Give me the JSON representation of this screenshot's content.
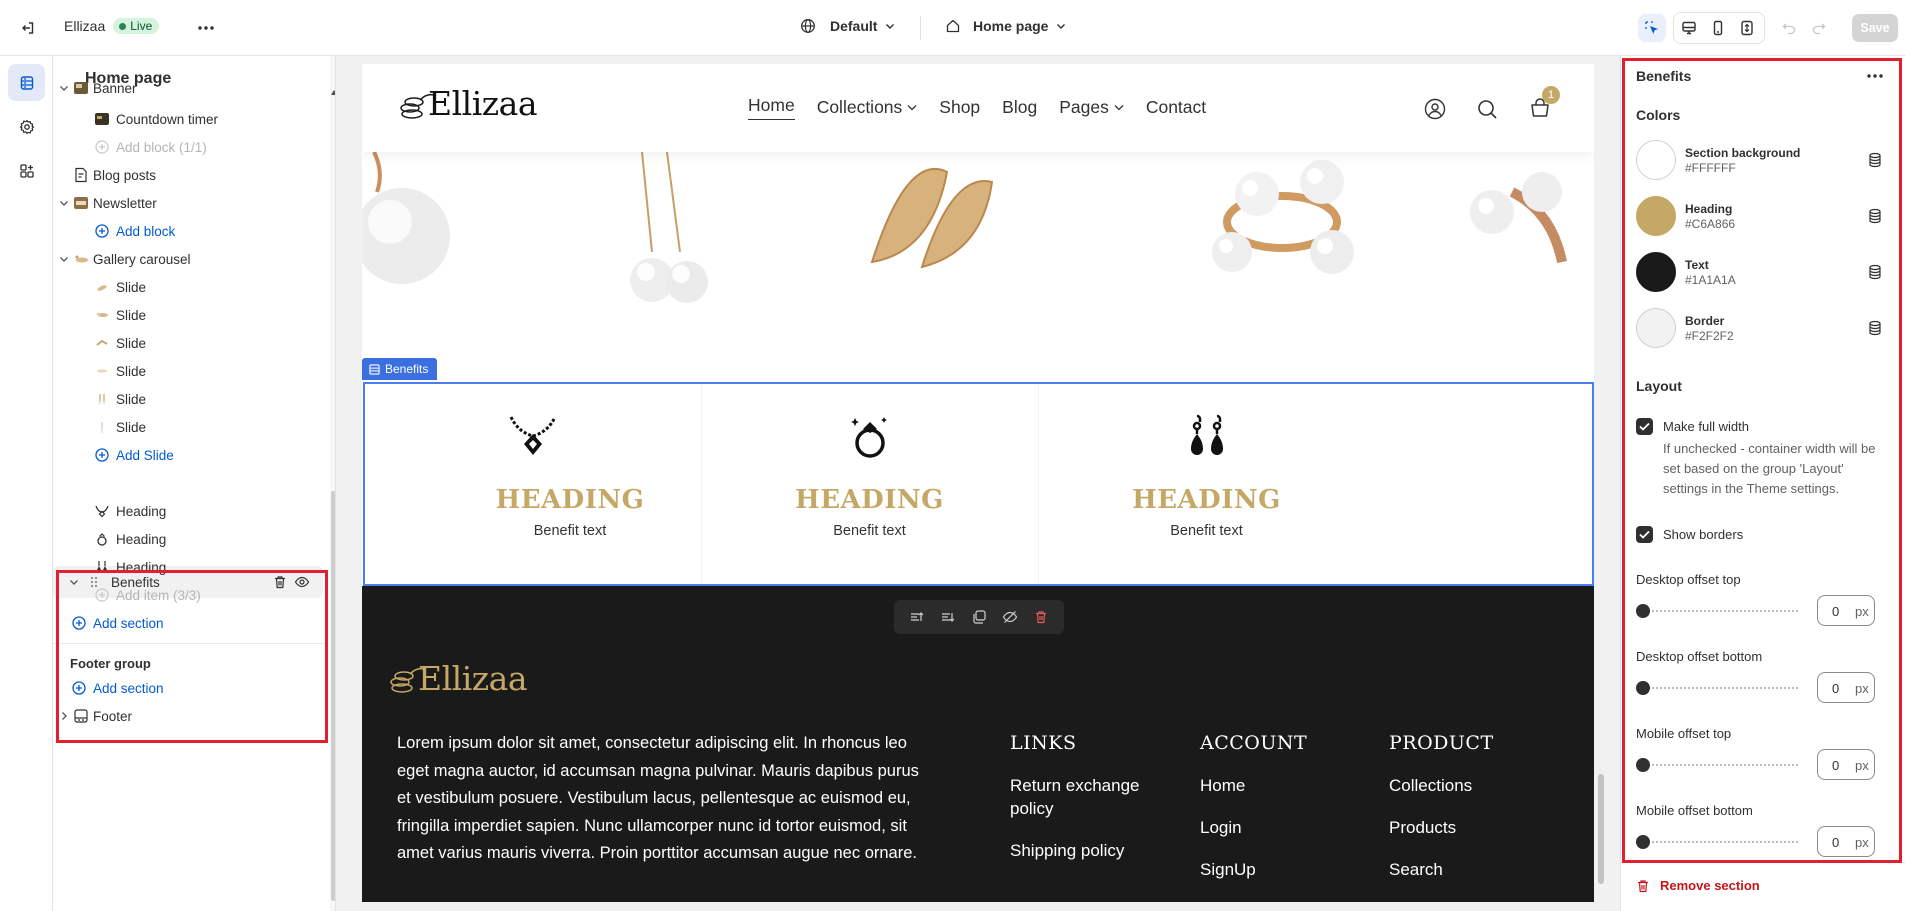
{
  "topbar": {
    "store_name": "Ellizaa",
    "live_badge": "Live",
    "theme_select": "Default",
    "page_select": "Home page",
    "save_label": "Save"
  },
  "tree": {
    "title": "Home page",
    "rows": [
      {
        "label": "Banner"
      },
      {
        "label": "Countdown timer"
      },
      {
        "label": "Add block (1/1)"
      },
      {
        "label": "Blog posts"
      },
      {
        "label": "Newsletter"
      },
      {
        "label": "Add block"
      },
      {
        "label": "Gallery carousel"
      },
      {
        "label": "Slide"
      },
      {
        "label": "Slide"
      },
      {
        "label": "Slide"
      },
      {
        "label": "Slide"
      },
      {
        "label": "Slide"
      },
      {
        "label": "Slide"
      },
      {
        "label": "Add Slide"
      },
      {
        "label": "Benefits"
      },
      {
        "label": "Heading"
      },
      {
        "label": "Heading"
      },
      {
        "label": "Heading"
      },
      {
        "label": "Add item (3/3)"
      },
      {
        "label": "Add section"
      },
      {
        "label": "Footer group"
      },
      {
        "label": "Add section"
      },
      {
        "label": "Footer"
      }
    ]
  },
  "preview": {
    "logo_text": "Ellizaa",
    "nav": [
      "Home",
      "Collections",
      "Shop",
      "Blog",
      "Pages",
      "Contact"
    ],
    "cart_count": "1",
    "section_tag": "Benefits",
    "benefits": [
      {
        "icon": "necklace-icon",
        "heading": "HEADING",
        "text": "Benefit text"
      },
      {
        "icon": "ring-icon",
        "heading": "HEADING",
        "text": "Benefit text"
      },
      {
        "icon": "earrings-icon",
        "heading": "HEADING",
        "text": "Benefit text"
      }
    ],
    "footer": {
      "logo_text": "Ellizaa",
      "text": "Lorem ipsum dolor sit amet, consectetur adipiscing elit. In rhoncus leo eget magna auctor, id accumsan magna pulvinar. Mauris dapibus purus et vestibulum posuere. Vestibulum lacus, pellentesque ac euismod eu, fringilla imperdiet sapien. Nunc ullamcorper nunc id tortor euismod, sit amet varius mauris viverra. Proin porttitor accumsan augue nec ornare.",
      "columns": [
        {
          "heading": "LINKS",
          "links": [
            "Return exchange policy",
            "Shipping policy"
          ]
        },
        {
          "heading": "ACCOUNT",
          "links": [
            "Home",
            "Login",
            "SignUp"
          ]
        },
        {
          "heading": "PRODUCT",
          "links": [
            "Collections",
            "Products",
            "Search"
          ]
        }
      ]
    }
  },
  "settings": {
    "title": "Benefits",
    "colors_heading": "Colors",
    "colors": [
      {
        "name": "Section background",
        "hex": "#FFFFFF"
      },
      {
        "name": "Heading",
        "hex": "#C6A866"
      },
      {
        "name": "Text",
        "hex": "#1A1A1A"
      },
      {
        "name": "Border",
        "hex": "#F2F2F2"
      }
    ],
    "layout_heading": "Layout",
    "full_width_label": "Make full width",
    "full_width_help": "If unchecked - container width will be set based on the group 'Layout' settings in the Theme settings.",
    "show_borders_label": "Show borders",
    "offsets": [
      {
        "label": "Desktop offset top",
        "value": "0",
        "unit": "px"
      },
      {
        "label": "Desktop offset bottom",
        "value": "0",
        "unit": "px"
      },
      {
        "label": "Mobile offset top",
        "value": "0",
        "unit": "px"
      },
      {
        "label": "Mobile offset bottom",
        "value": "0",
        "unit": "px"
      }
    ],
    "remove_label": "Remove section"
  },
  "colors": {
    "accent": "#005bd3",
    "gold": "#c6a866",
    "highlight": "#e0202e",
    "selection": "#4b7cf0"
  }
}
